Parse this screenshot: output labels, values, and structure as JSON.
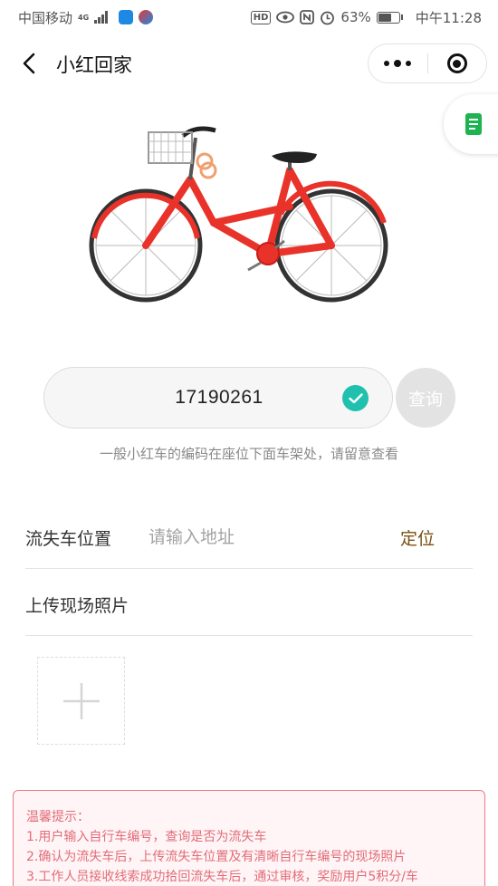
{
  "status_bar": {
    "carrier": "中国移动",
    "network": "4G",
    "hd": "HD",
    "battery": "63%",
    "battery_level": 0.63,
    "time": "中午11:28"
  },
  "nav": {
    "title": "小红回家"
  },
  "code_input": {
    "value": "17190261",
    "query_label": "查询",
    "hint": "一般小红车的编码在座位下面车架处，请留意查看"
  },
  "location": {
    "label": "流失车位置",
    "placeholder": "请输入地址",
    "locate_label": "定位"
  },
  "photo": {
    "label": "上传现场照片"
  },
  "notice": {
    "title": "温馨提示：",
    "lines": [
      "1.用户输入自行车编号，查询是否为流失车",
      "2.确认为流失车后，上传流失车位置及有清晰自行车编号的现场照片",
      "3.工作人员接收线索成功拾回流失车后，通过审核，奖励用户5积分/车"
    ]
  },
  "colors": {
    "check_badge": "#1fc1ae",
    "locate_text": "#7b4f12",
    "notice_text": "#e26c78",
    "notice_border": "#f07a8a",
    "bike_red": "#e8322a"
  }
}
